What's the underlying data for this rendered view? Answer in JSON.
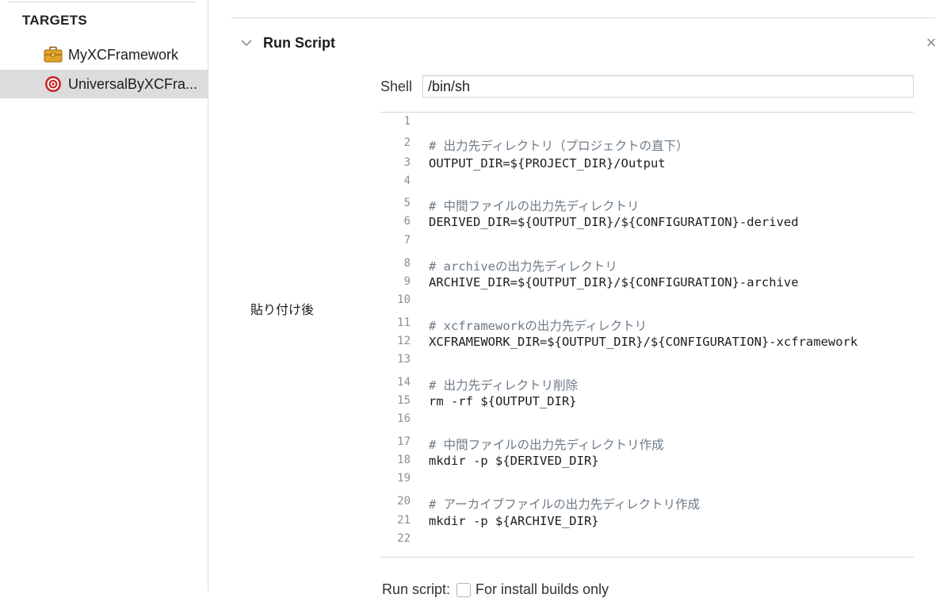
{
  "sidebar": {
    "heading": "TARGETS",
    "targets": [
      {
        "label": "MyXCFramework",
        "icon": "toolbox-icon",
        "selected": false
      },
      {
        "label": "UniversalByXCFra...",
        "icon": "target-icon",
        "selected": true
      }
    ]
  },
  "phase": {
    "title": "Run Script",
    "shell_label": "Shell",
    "shell_value": "/bin/sh"
  },
  "annotation": "貼り付け後",
  "script_lines": [
    {
      "n": "1",
      "text": ""
    },
    {
      "n": "2",
      "text": "# 出力先ディレクトリ（プロジェクトの直下）"
    },
    {
      "n": "3",
      "text": "OUTPUT_DIR=${PROJECT_DIR}/Output"
    },
    {
      "n": "4",
      "text": ""
    },
    {
      "n": "5",
      "text": "# 中間ファイルの出力先ディレクトリ"
    },
    {
      "n": "6",
      "text": "DERIVED_DIR=${OUTPUT_DIR}/${CONFIGURATION}-derived"
    },
    {
      "n": "7",
      "text": ""
    },
    {
      "n": "8",
      "text": "# archiveの出力先ディレクトリ"
    },
    {
      "n": "9",
      "text": "ARCHIVE_DIR=${OUTPUT_DIR}/${CONFIGURATION}-archive"
    },
    {
      "n": "10",
      "text": ""
    },
    {
      "n": "11",
      "text": "# xcframeworkの出力先ディレクトリ"
    },
    {
      "n": "12",
      "text": "XCFRAMEWORK_DIR=${OUTPUT_DIR}/${CONFIGURATION}-xcframework"
    },
    {
      "n": "13",
      "text": ""
    },
    {
      "n": "14",
      "text": "# 出力先ディレクトリ削除"
    },
    {
      "n": "15",
      "text": "rm -rf ${OUTPUT_DIR}"
    },
    {
      "n": "16",
      "text": ""
    },
    {
      "n": "17",
      "text": "# 中間ファイルの出力先ディレクトリ作成"
    },
    {
      "n": "18",
      "text": "mkdir -p ${DERIVED_DIR}"
    },
    {
      "n": "19",
      "text": ""
    },
    {
      "n": "20",
      "text": "# アーカイブファイルの出力先ディレクトリ作成"
    },
    {
      "n": "21",
      "text": "mkdir -p ${ARCHIVE_DIR}"
    },
    {
      "n": "22",
      "text": ""
    }
  ],
  "footer": {
    "run_script_label": "Run script:",
    "install_builds_label": "For install builds only",
    "install_builds_checked": false
  },
  "colors": {
    "selection": "#dcdcdc",
    "comment": "#6e7a86",
    "line_number": "#8e8e93",
    "target_icon": "#c62828",
    "toolbox_icon": "#e0a526"
  }
}
